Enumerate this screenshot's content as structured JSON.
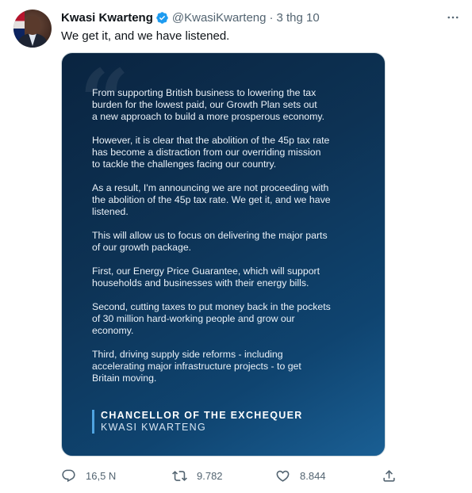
{
  "author": {
    "name": "Kwasi Kwarteng",
    "handle": "@KwasiKwarteng",
    "separator": "·",
    "time": "3 thg 10",
    "verified_icon": "verified-badge-icon"
  },
  "tweet_text": "We get it, and we have listened.",
  "statement": {
    "paragraphs": [
      "From supporting British business to lowering the tax\nburden for the lowest paid, our Growth Plan sets out\na new approach to build a more prosperous economy.",
      "However, it is clear that the abolition of the 45p tax rate\nhas become a distraction from our overriding mission\nto tackle the challenges facing our country.",
      "As a result, I'm announcing we are not proceeding with\nthe abolition of the 45p tax rate. We get it, and we have\nlistened.",
      "This will allow us to focus on delivering the major parts\nof our growth package.",
      "First, our Energy Price Guarantee, which will support\nhouseholds and businesses with their energy bills.",
      "Second, cutting taxes to put money back in the pockets\nof 30 million hard-working people and grow our\neconomy.",
      "Third, driving supply side reforms - including\naccelerating major infrastructure projects - to get\nBritain moving."
    ],
    "signature_title": "CHANCELLOR OF THE EXCHEQUER",
    "signature_name": "KWASI KWARTENG"
  },
  "actions": {
    "replies": "16,5 N",
    "retweets": "9.782",
    "likes": "8.844"
  },
  "colors": {
    "accent": "#1d9bf0",
    "secondary_text": "#536471",
    "card_gradient_start": "#0a2440",
    "card_gradient_end": "#1a5f94"
  }
}
